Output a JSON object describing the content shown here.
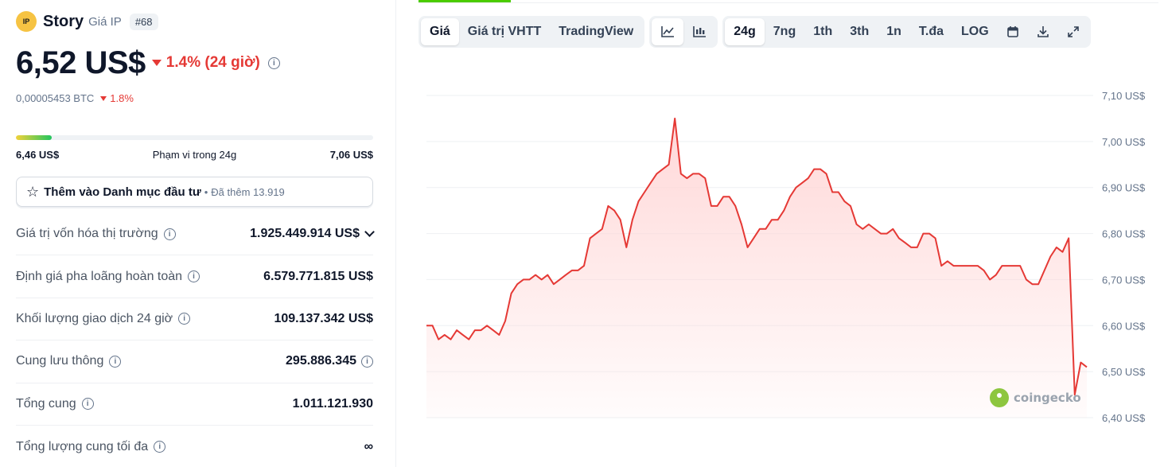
{
  "coin": {
    "logo_text": "IP",
    "name": "Story",
    "subtitle": "Giá IP",
    "rank": "#68"
  },
  "price": {
    "value": "6,52 US$",
    "change": "1.4% (24 giờ)",
    "btc_value": "0,00005453 BTC",
    "btc_change": "1.8%"
  },
  "range": {
    "low": "6,46 US$",
    "label": "Phạm vi trong 24g",
    "high": "7,06 US$",
    "position_fraction": 0.1
  },
  "watchlist": {
    "label": "Thêm vào Danh mục đầu tư",
    "dot": "•",
    "count": "Đã thêm 13.919"
  },
  "stats": [
    {
      "label": "Giá trị vốn hóa thị trường",
      "value": "1.925.449.914 US$"
    },
    {
      "label": "Định giá pha loãng hoàn toàn",
      "value": "6.579.771.815 US$"
    },
    {
      "label": "Khối lượng giao dịch 24 giờ",
      "value": "109.137.342 US$"
    },
    {
      "label": "Cung lưu thông",
      "value": "295.886.345"
    },
    {
      "label": "Tổng cung",
      "value": "1.011.121.930"
    },
    {
      "label": "Tổng lượng cung tối đa",
      "value": "∞"
    }
  ],
  "toolbar": {
    "views": [
      "Giá",
      "Giá trị VHTT",
      "TradingView"
    ],
    "chart_types": [
      "line-chart-icon",
      "candlestick-icon"
    ],
    "ranges": [
      "24g",
      "7ng",
      "1th",
      "3th",
      "1n",
      "T.đa",
      "LOG"
    ],
    "actions": [
      "calendar-icon",
      "download-icon",
      "expand-icon"
    ]
  },
  "colors": {
    "line": "#e53935",
    "fill": "#ffd6d6",
    "down": "#e53935",
    "accent": "#4bcc00"
  },
  "watermark": "coingecko",
  "chart_data": {
    "type": "area",
    "y_ticks": [
      "7,10 US$",
      "7,00 US$",
      "6,90 US$",
      "6,80 US$",
      "6,70 US$",
      "6,60 US$",
      "6,50 US$",
      "6,40 US$"
    ],
    "ylim": [
      6.4,
      7.1
    ],
    "grid": true,
    "values": [
      6.6,
      6.6,
      6.57,
      6.58,
      6.57,
      6.59,
      6.58,
      6.57,
      6.59,
      6.59,
      6.6,
      6.59,
      6.58,
      6.61,
      6.67,
      6.69,
      6.7,
      6.7,
      6.71,
      6.7,
      6.71,
      6.69,
      6.7,
      6.71,
      6.72,
      6.72,
      6.73,
      6.79,
      6.8,
      6.81,
      6.86,
      6.85,
      6.83,
      6.77,
      6.83,
      6.87,
      6.89,
      6.91,
      6.93,
      6.94,
      6.95,
      7.05,
      6.93,
      6.92,
      6.93,
      6.93,
      6.92,
      6.86,
      6.86,
      6.88,
      6.88,
      6.86,
      6.82,
      6.77,
      6.79,
      6.81,
      6.81,
      6.83,
      6.83,
      6.85,
      6.88,
      6.9,
      6.91,
      6.92,
      6.94,
      6.94,
      6.93,
      6.89,
      6.89,
      6.87,
      6.86,
      6.82,
      6.81,
      6.82,
      6.81,
      6.8,
      6.8,
      6.81,
      6.79,
      6.78,
      6.77,
      6.77,
      6.8,
      6.8,
      6.79,
      6.73,
      6.74,
      6.73,
      6.73,
      6.73,
      6.73,
      6.73,
      6.72,
      6.7,
      6.71,
      6.73,
      6.73,
      6.73,
      6.73,
      6.7,
      6.69,
      6.69,
      6.72,
      6.75,
      6.77,
      6.76,
      6.79,
      6.45,
      6.52,
      6.51
    ]
  }
}
